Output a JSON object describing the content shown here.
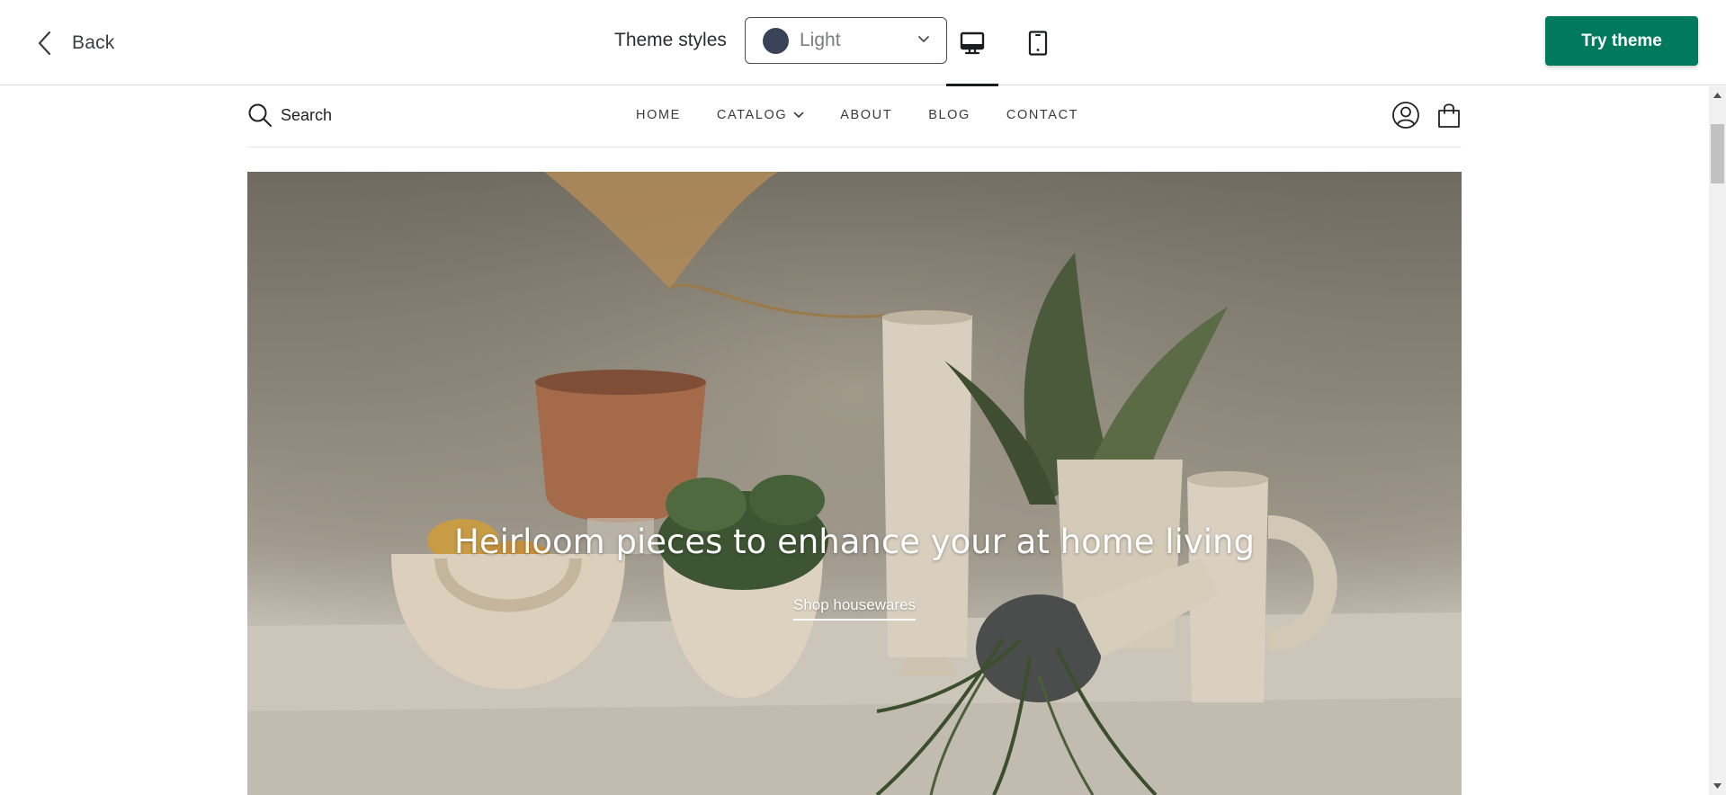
{
  "toolbar": {
    "back_label": "Back",
    "theme_styles_label": "Theme styles",
    "theme_select": {
      "value": "Light",
      "swatch_color": "#3a4258"
    },
    "devices": [
      {
        "icon": "desktop-icon",
        "active": true
      },
      {
        "icon": "tablet-icon",
        "active": false
      }
    ],
    "try_theme_label": "Try theme",
    "accent_color": "#007a5e"
  },
  "store": {
    "search_label": "Search",
    "nav": [
      "HOME",
      "CATALOG",
      "ABOUT",
      "BLOG",
      "CONTACT"
    ],
    "header_icons": [
      "account-icon",
      "cart-icon"
    ],
    "hero": {
      "title": "Heirloom pieces to enhance your at home living",
      "link_label": "Shop housewares"
    }
  }
}
